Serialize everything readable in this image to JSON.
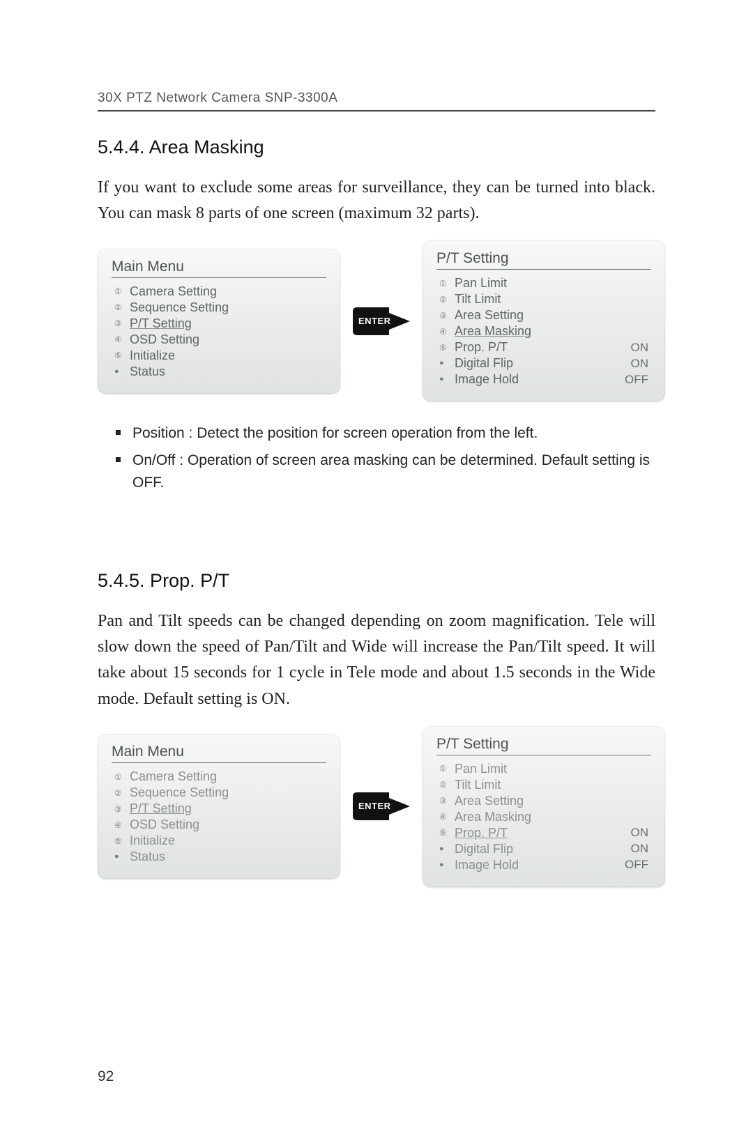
{
  "page": {
    "header": "30X PTZ Network Camera SNP-3300A",
    "number": "92"
  },
  "section1": {
    "heading": "5.4.4. Area Masking",
    "paragraph": "If you want to exclude some areas for surveillance, they can be turned into black. You can mask 8 parts of one screen (maximum 32 parts).",
    "bullets": [
      "Position : Detect the position for screen operation from the left.",
      "On/Off : Operation of screen area masking can be determined. Default setting is OFF."
    ]
  },
  "section2": {
    "heading": "5.4.5. Prop. P/T",
    "paragraph": "Pan and Tilt speeds can be changed depending on zoom magnification. Tele will slow down the speed of Pan/Tilt and Wide will increase the Pan/Tilt speed. It will take about 15 seconds for 1 cycle in Tele mode and about 1.5 seconds in the Wide mode. Default setting is ON."
  },
  "enter_label": "ENTER",
  "diagram1": {
    "left": {
      "title": "Main Menu",
      "items": [
        {
          "m": "①",
          "label": "Camera Setting",
          "val": "",
          "ul": false,
          "muted": false
        },
        {
          "m": "②",
          "label": "Sequence Setting",
          "val": "",
          "ul": false,
          "muted": false
        },
        {
          "m": "③",
          "label": "P/T Setting",
          "val": "",
          "ul": true,
          "muted": false
        },
        {
          "m": "④",
          "label": "OSD Setting",
          "val": "",
          "ul": false,
          "muted": false
        },
        {
          "m": "⑤",
          "label": "Initialize",
          "val": "",
          "ul": false,
          "muted": false
        },
        {
          "m": "●",
          "label": "Status",
          "val": "",
          "ul": false,
          "muted": false
        }
      ]
    },
    "right": {
      "title": "P/T Setting",
      "items": [
        {
          "m": "①",
          "label": "Pan Limit",
          "val": "",
          "ul": false,
          "muted": false
        },
        {
          "m": "②",
          "label": "Tilt Limit",
          "val": "",
          "ul": false,
          "muted": false
        },
        {
          "m": "③",
          "label": "Area Setting",
          "val": "",
          "ul": false,
          "muted": false
        },
        {
          "m": "④",
          "label": "Area Masking",
          "val": "",
          "ul": true,
          "muted": false
        },
        {
          "m": "⑤",
          "label": "Prop. P/T",
          "val": "ON",
          "ul": false,
          "muted": false
        },
        {
          "m": "●",
          "label": "Digital Flip",
          "val": "ON",
          "ul": false,
          "muted": false
        },
        {
          "m": "●",
          "label": "Image Hold",
          "val": "OFF",
          "ul": false,
          "muted": false
        }
      ]
    }
  },
  "diagram2": {
    "left": {
      "title": "Main Menu",
      "items": [
        {
          "m": "①",
          "label": "Camera Setting",
          "val": "",
          "ul": false,
          "muted": true
        },
        {
          "m": "②",
          "label": "Sequence Setting",
          "val": "",
          "ul": false,
          "muted": true
        },
        {
          "m": "③",
          "label": "P/T Setting",
          "val": "",
          "ul": true,
          "muted": true
        },
        {
          "m": "④",
          "label": "OSD Setting",
          "val": "",
          "ul": false,
          "muted": true
        },
        {
          "m": "⑤",
          "label": "Initialize",
          "val": "",
          "ul": false,
          "muted": true
        },
        {
          "m": "●",
          "label": "Status",
          "val": "",
          "ul": false,
          "muted": true
        }
      ]
    },
    "right": {
      "title": "P/T Setting",
      "items": [
        {
          "m": "①",
          "label": "Pan Limit",
          "val": "",
          "ul": false,
          "muted": true
        },
        {
          "m": "②",
          "label": "Tilt Limit",
          "val": "",
          "ul": false,
          "muted": true
        },
        {
          "m": "③",
          "label": "Area Setting",
          "val": "",
          "ul": false,
          "muted": true
        },
        {
          "m": "④",
          "label": "Area Masking",
          "val": "",
          "ul": false,
          "muted": true
        },
        {
          "m": "⑤",
          "label": "Prop. P/T",
          "val": "ON",
          "ul": true,
          "muted": true
        },
        {
          "m": "●",
          "label": "Digital Flip",
          "val": "ON",
          "ul": false,
          "muted": true
        },
        {
          "m": "●",
          "label": "Image Hold",
          "val": "OFF",
          "ul": false,
          "muted": true
        }
      ]
    }
  }
}
